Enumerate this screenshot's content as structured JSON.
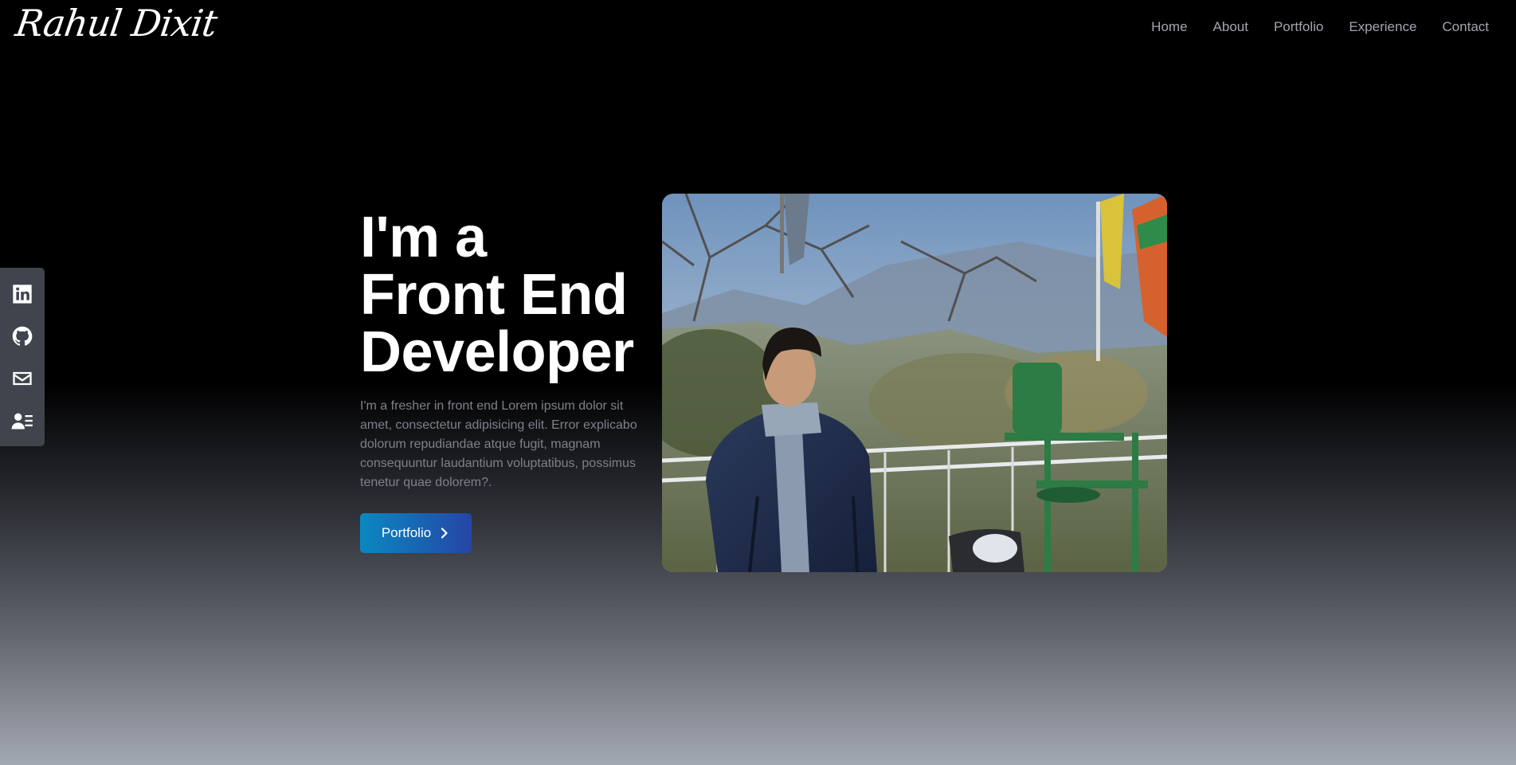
{
  "header": {
    "logo": "Rahul Dixit",
    "nav": [
      "Home",
      "About",
      "Portfolio",
      "Experience",
      "Contact"
    ]
  },
  "social": {
    "icons": [
      "linkedin-icon",
      "github-icon",
      "mail-icon",
      "resume-icon"
    ]
  },
  "hero": {
    "title_line1": "I'm a",
    "title_line2": "Front End",
    "title_line3": "Developer",
    "description": "I'm a fresher in front end Lorem ipsum dolor sit amet, consectetur adipisicing elit. Error explicabo dolorum repudiandae atque fugit, magnam consequuntur laudantium voluptatibus, possimus tenetur quae dolorem?.",
    "button_label": "Portfolio",
    "button_icon": "chevron-right-icon"
  },
  "colors": {
    "background_top": "#000000",
    "background_bottom": "#a3a8b2",
    "nav_text": "#a2a6b0",
    "description_text": "#7d818a",
    "sidebar": "#3f444d",
    "button_gradient_start": "#0a88c0",
    "button_gradient_end": "#2546a6"
  }
}
